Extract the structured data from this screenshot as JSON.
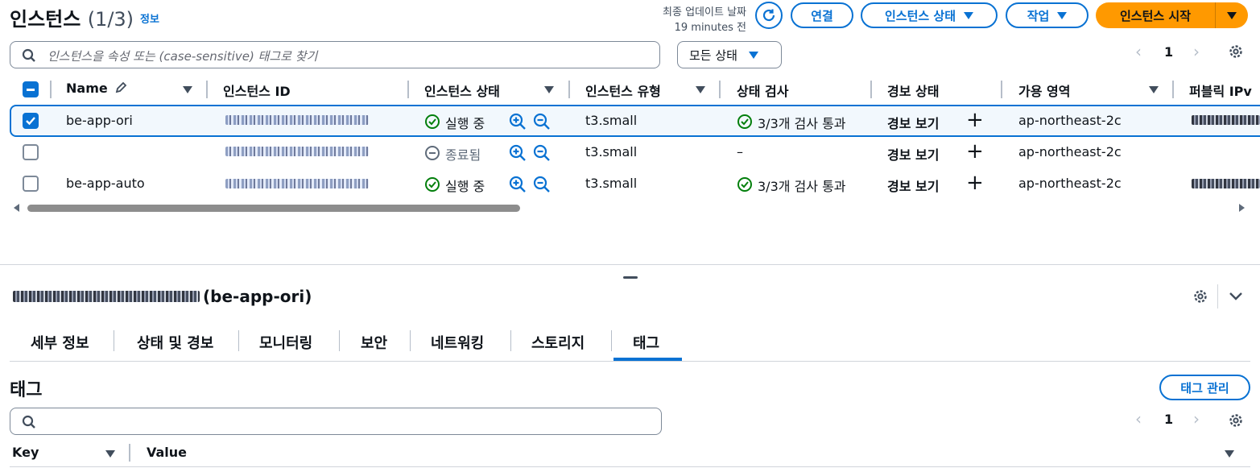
{
  "header": {
    "title": "인스턴스",
    "count": "(1/3)",
    "info_link": "정보",
    "last_updated_label": "최종 업데이트 날짜",
    "last_updated_value": "19 minutes 전",
    "connect_button": "연결",
    "instance_state_button": "인스턴스 상태",
    "actions_button": "작업",
    "start_instance_button": "인스턴스 시작"
  },
  "filter": {
    "search_placeholder": "인스턴스을 속성 또는 (case-sensitive) 태그로 찾기",
    "state_select": "모든 상태"
  },
  "pagination": {
    "page": "1"
  },
  "table": {
    "columns": [
      "Name",
      "인스턴스 ID",
      "인스턴스 상태",
      "인스턴스 유형",
      "상태 검사",
      "경보 상태",
      "가용 영역",
      "퍼블릭 IPv"
    ],
    "rows": [
      {
        "name": "be-app-ori",
        "state": "실행 중",
        "type": "t3.small",
        "check": "3/3개 검사 통과",
        "alarm": "경보 보기",
        "az": "ap-northeast-2c",
        "selected": true
      },
      {
        "name": "",
        "state": "종료됨",
        "type": "t3.small",
        "check": "–",
        "alarm": "경보 보기",
        "az": "ap-northeast-2c",
        "selected": false
      },
      {
        "name": "be-app-auto",
        "state": "실행 중",
        "type": "t3.small",
        "check": "3/3개 검사 통과",
        "alarm": "경보 보기",
        "az": "ap-northeast-2c",
        "selected": false
      }
    ]
  },
  "detail": {
    "title_suffix": "(be-app-ori)",
    "tabs": [
      "세부 정보",
      "상태 및 경보",
      "모니터링",
      "보안",
      "네트워킹",
      "스토리지",
      "태그"
    ],
    "active_tab": "태그",
    "section_title": "태그",
    "manage_tags_button": "태그 관리",
    "page": "1",
    "columns": [
      "Key",
      "Value"
    ]
  },
  "colors": {
    "accent": "#0972d3",
    "primary_button": "#ff9900",
    "success": "#037f0c",
    "selected_row": "#f2f8fd"
  },
  "icons": [
    "refresh-icon",
    "search-icon",
    "settings-icon",
    "edit-icon",
    "check-circle-icon",
    "minus-circle-icon",
    "zoom-in-icon",
    "zoom-out-icon",
    "plus-icon",
    "chevron-down-icon"
  ]
}
